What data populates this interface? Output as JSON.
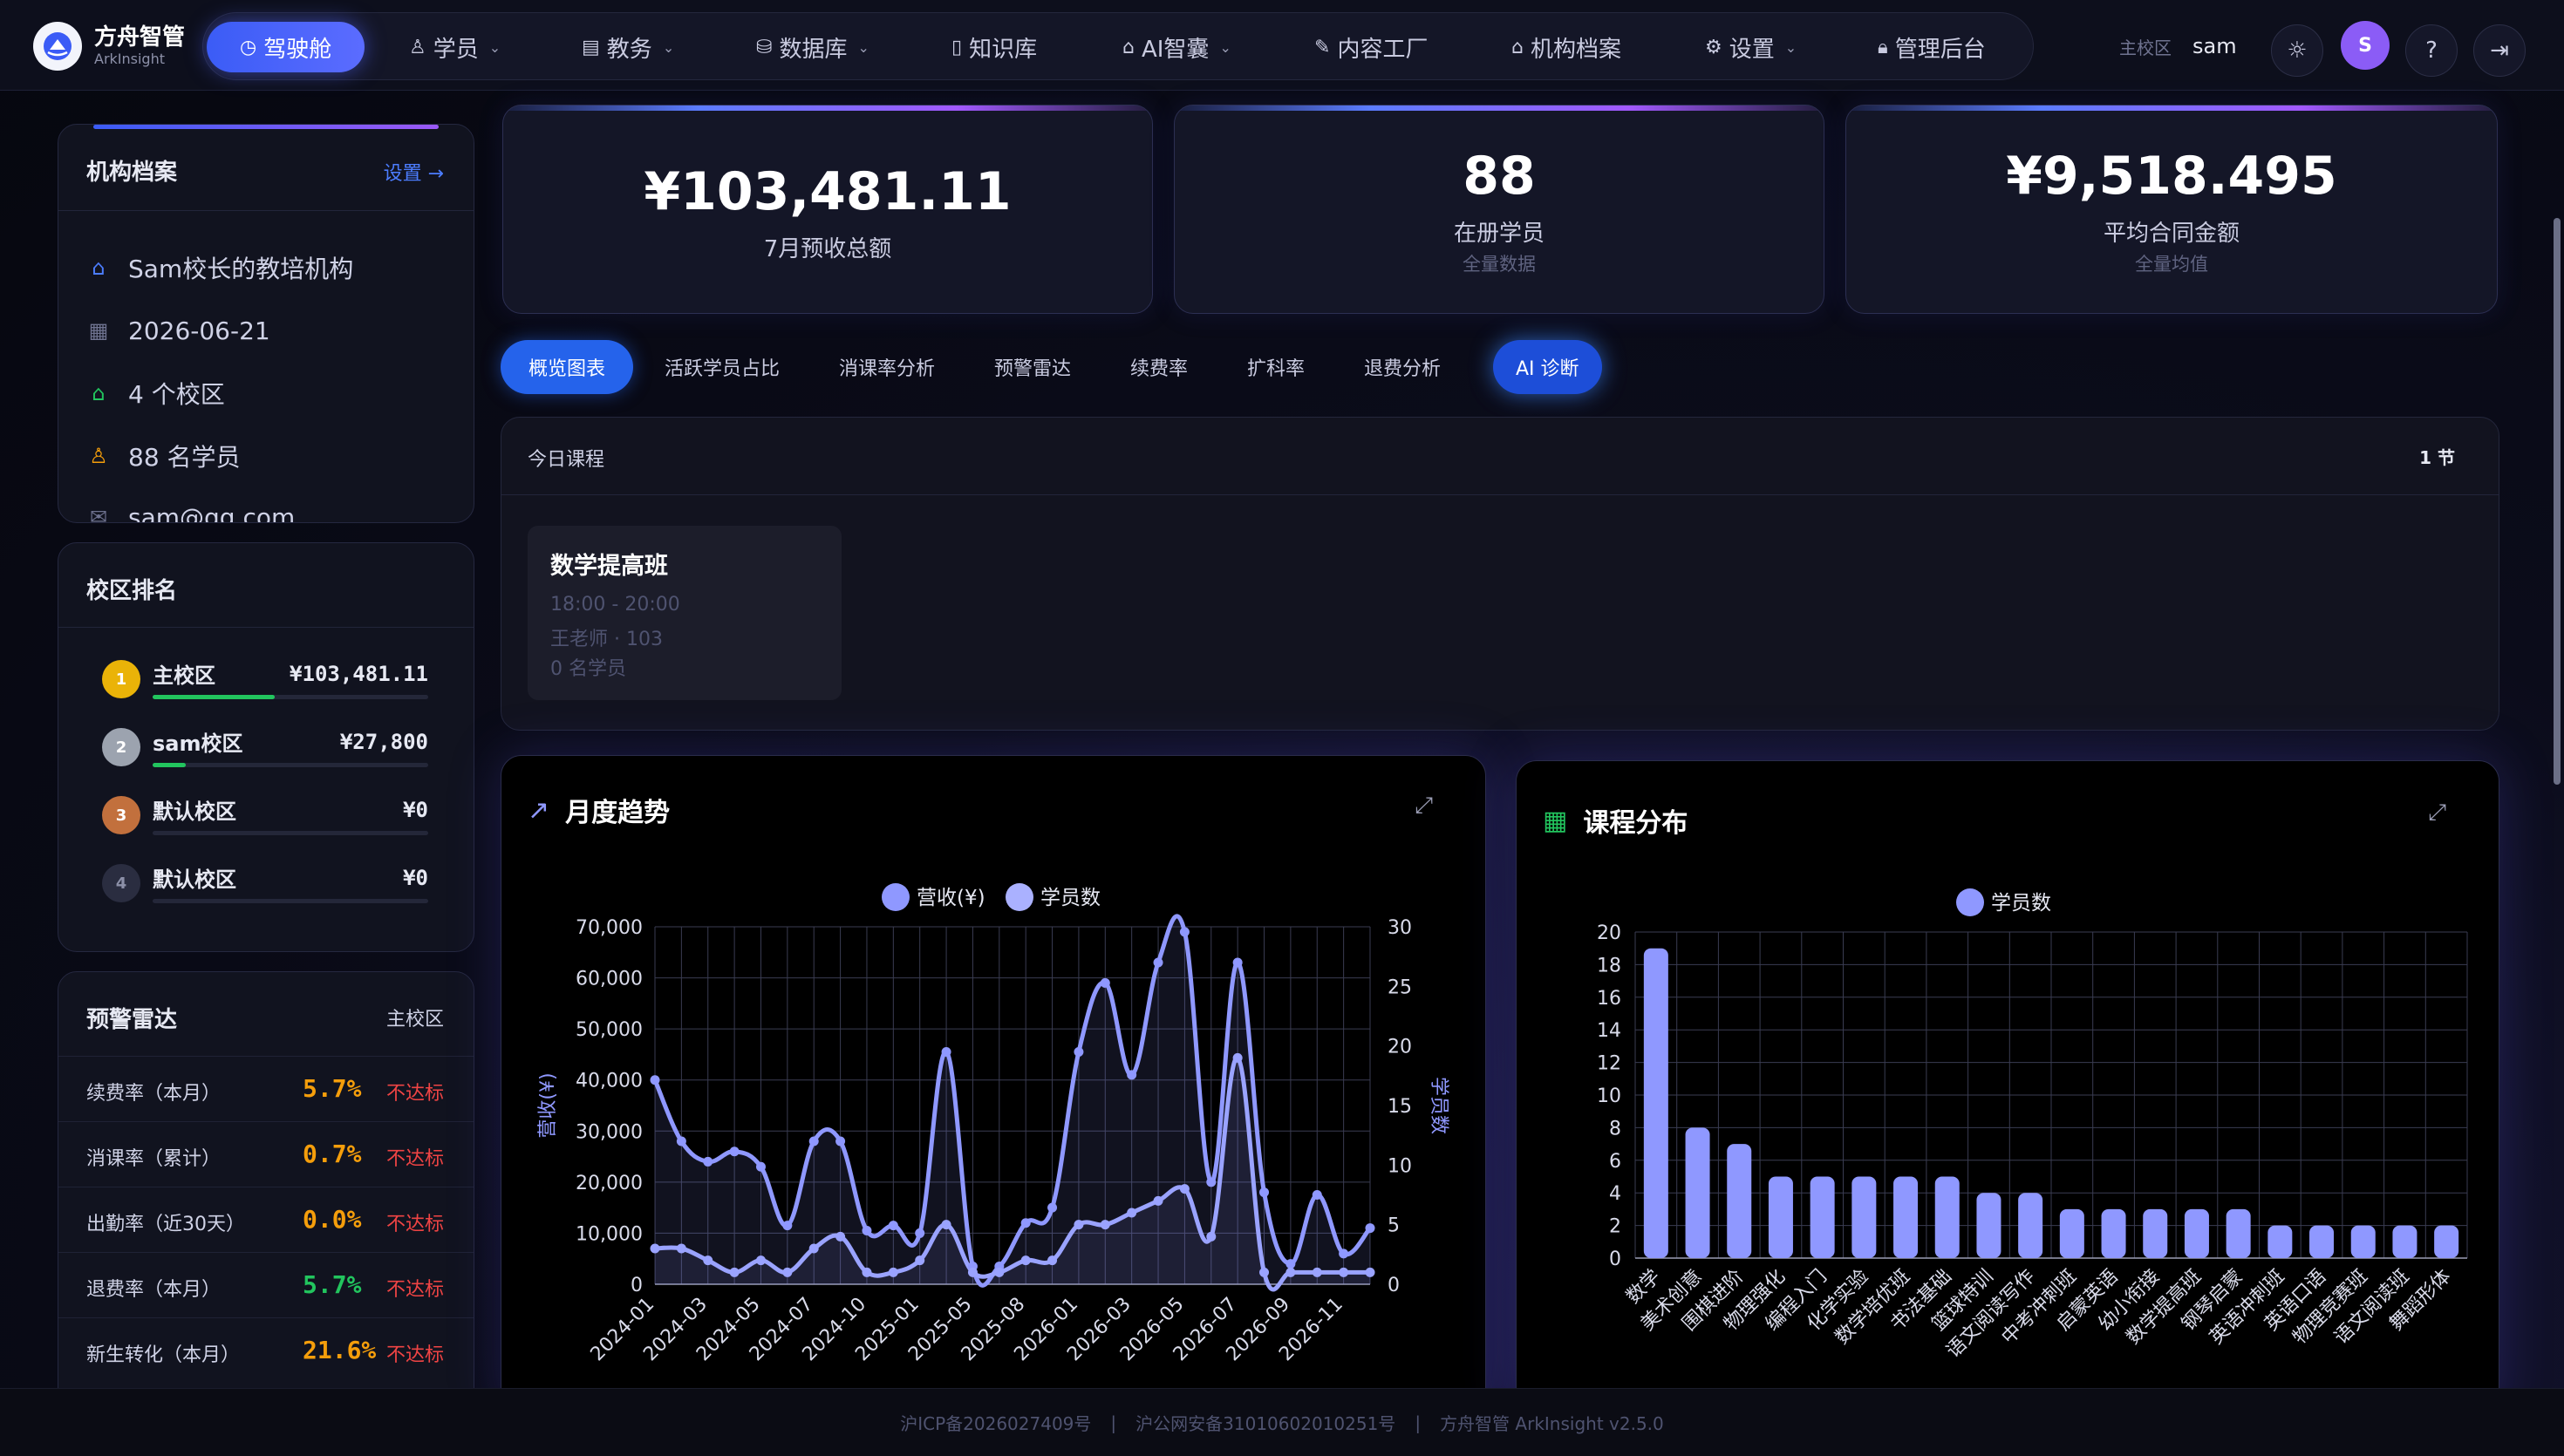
{
  "brand": {
    "name": "方舟智管",
    "sub": "ArkInsight"
  },
  "nav": {
    "items": [
      {
        "label": "驾驶舱",
        "icon": "clock-icon",
        "active": true
      },
      {
        "label": "学员",
        "icon": "user-icon",
        "dropdown": true
      },
      {
        "label": "教务",
        "icon": "clipboard-icon",
        "dropdown": true
      },
      {
        "label": "数据库",
        "icon": "database-icon",
        "dropdown": true
      },
      {
        "label": "知识库",
        "icon": "book-icon"
      },
      {
        "label": "AI智囊",
        "icon": "robot-icon",
        "dropdown": true
      },
      {
        "label": "内容工厂",
        "icon": "edit-icon"
      },
      {
        "label": "机构档案",
        "icon": "home-icon"
      },
      {
        "label": "设置",
        "icon": "gear-icon",
        "dropdown": true
      },
      {
        "label": "管理后台",
        "icon": "lock-icon"
      }
    ]
  },
  "user": {
    "campus": "主校区",
    "name": "sam",
    "avatar_letter": "S"
  },
  "org": {
    "title": "机构档案",
    "setting_link": "设置 →",
    "name": "Sam校长的教培机构",
    "date": "2026-06-21",
    "campuses": "4 个校区",
    "students": "88 名学员",
    "email": "sam@qq.com"
  },
  "ranking": {
    "title": "校区排名",
    "items": [
      {
        "rank": "1",
        "name": "主校区",
        "value": "¥103,481.11",
        "progress": 1.0,
        "color": "#eab308"
      },
      {
        "rank": "2",
        "name": "sam校区",
        "value": "¥27,800",
        "progress": 0.27,
        "color": "#9ca3af"
      },
      {
        "rank": "3",
        "name": "默认校区",
        "value": "¥0",
        "progress": 0,
        "color": "#c2703d"
      },
      {
        "rank": "4",
        "name": "默认校区",
        "value": "¥0",
        "progress": 0,
        "color": "#2a2d40"
      }
    ]
  },
  "radar": {
    "title": "预警雷达",
    "campus": "主校区",
    "items": [
      {
        "label": "续费率（本月）",
        "value": "5.7%",
        "status": "不达标",
        "color": "#f59e0b"
      },
      {
        "label": "消课率（累计）",
        "value": "0.7%",
        "status": "不达标",
        "color": "#f59e0b"
      },
      {
        "label": "出勤率（近30天）",
        "value": "0.0%",
        "status": "不达标",
        "color": "#f59e0b"
      },
      {
        "label": "退费率（本月）",
        "value": "5.7%",
        "status": "不达标",
        "color": "#22c55e"
      },
      {
        "label": "新生转化（本月）",
        "value": "21.6%",
        "status": "不达标",
        "color": "#f59e0b"
      }
    ]
  },
  "stats": [
    {
      "value": "¥103,481.11",
      "label": "7月预收总额",
      "sub": ""
    },
    {
      "value": "88",
      "label": "在册学员",
      "sub": "全量数据"
    },
    {
      "value": "¥9,518.495",
      "label": "平均合同金额",
      "sub": "全量均值"
    }
  ],
  "tabs": [
    "概览图表",
    "活跃学员占比",
    "消课率分析",
    "预警雷达",
    "续费率",
    "扩科率",
    "退费分析",
    "AI 诊断"
  ],
  "today": {
    "title": "今日课程",
    "count": "1 节",
    "course": {
      "name": "数学提高班",
      "time": "18:00 - 20:00",
      "teacher": "王老师 · 103",
      "students": "0 名学员"
    }
  },
  "trend": {
    "title": "月度趋势",
    "legend": [
      "营收(¥)",
      "学员数"
    ],
    "y_left_label": "营收(¥)",
    "y_right_label": "学员数"
  },
  "dist": {
    "title": "课程分布",
    "legend": "学员数"
  },
  "chart_data": [
    {
      "type": "line",
      "title": "月度趋势",
      "ylabel": "营收(¥)",
      "y2label": "学员数",
      "ylim": [
        0,
        70000
      ],
      "y2lim": [
        0,
        30
      ],
      "yticks": [
        0,
        10000,
        20000,
        30000,
        40000,
        50000,
        60000,
        70000
      ],
      "y2ticks": [
        0,
        5,
        10,
        15,
        20,
        25,
        30
      ],
      "xtick_labels": [
        "2024-01",
        "2024-03",
        "2024-05",
        "2024-07",
        "2024-10",
        "2025-01",
        "2025-05",
        "2025-08",
        "2026-01",
        "2026-03",
        "2026-05",
        "2026-07",
        "2026-09",
        "2026-11"
      ],
      "grid": true,
      "legend_position": "top",
      "series": [
        {
          "name": "营收(¥)",
          "color": "#8f98ff",
          "axis": "left",
          "values": [
            40000,
            28000,
            24000,
            26000,
            23000,
            11500,
            28000,
            28000,
            10500,
            11500,
            10000,
            45500,
            3500,
            3500,
            12000,
            15000,
            45500,
            59000,
            41000,
            63000,
            69000,
            20000,
            63000,
            18000,
            4000,
            17500,
            6000,
            11000
          ]
        },
        {
          "name": "学员数",
          "color": "#8f98ff",
          "axis": "right",
          "values": [
            3,
            3,
            2,
            1,
            2,
            1,
            3,
            4,
            1,
            1,
            2,
            5,
            1,
            1,
            2,
            2,
            5,
            5,
            6,
            7,
            8,
            4,
            19,
            1,
            1,
            1,
            1,
            1
          ]
        }
      ]
    },
    {
      "type": "bar",
      "title": "课程分布",
      "ylim": [
        0,
        20
      ],
      "yticks": [
        0,
        2,
        4,
        6,
        8,
        10,
        12,
        14,
        16,
        18,
        20
      ],
      "grid": true,
      "legend_position": "top",
      "categories": [
        "数学",
        "美术创意",
        "围棋进阶",
        "物理强化",
        "编程入门",
        "化学实验",
        "数学培优班",
        "书法基础",
        "篮球特训",
        "语文阅读写作",
        "中考冲刺班",
        "启蒙英语",
        "幼小衔接",
        "数学提高班",
        "钢琴启蒙",
        "英语冲刺班",
        "英语口语",
        "物理竞赛班",
        "语文阅读班",
        "舞蹈形体"
      ],
      "series": [
        {
          "name": "学员数",
          "color": "#8f98ff",
          "values": [
            19,
            8,
            7,
            5,
            5,
            5,
            5,
            5,
            4,
            4,
            3,
            3,
            3,
            3,
            3,
            2,
            2,
            2,
            2,
            2
          ]
        }
      ]
    }
  ],
  "footer": {
    "icp": "沪ICP备2026027409号",
    "police": "沪公网安备31010602010251号",
    "product": "方舟智管 ArkInsight v2.5.0",
    "sep": "|"
  }
}
